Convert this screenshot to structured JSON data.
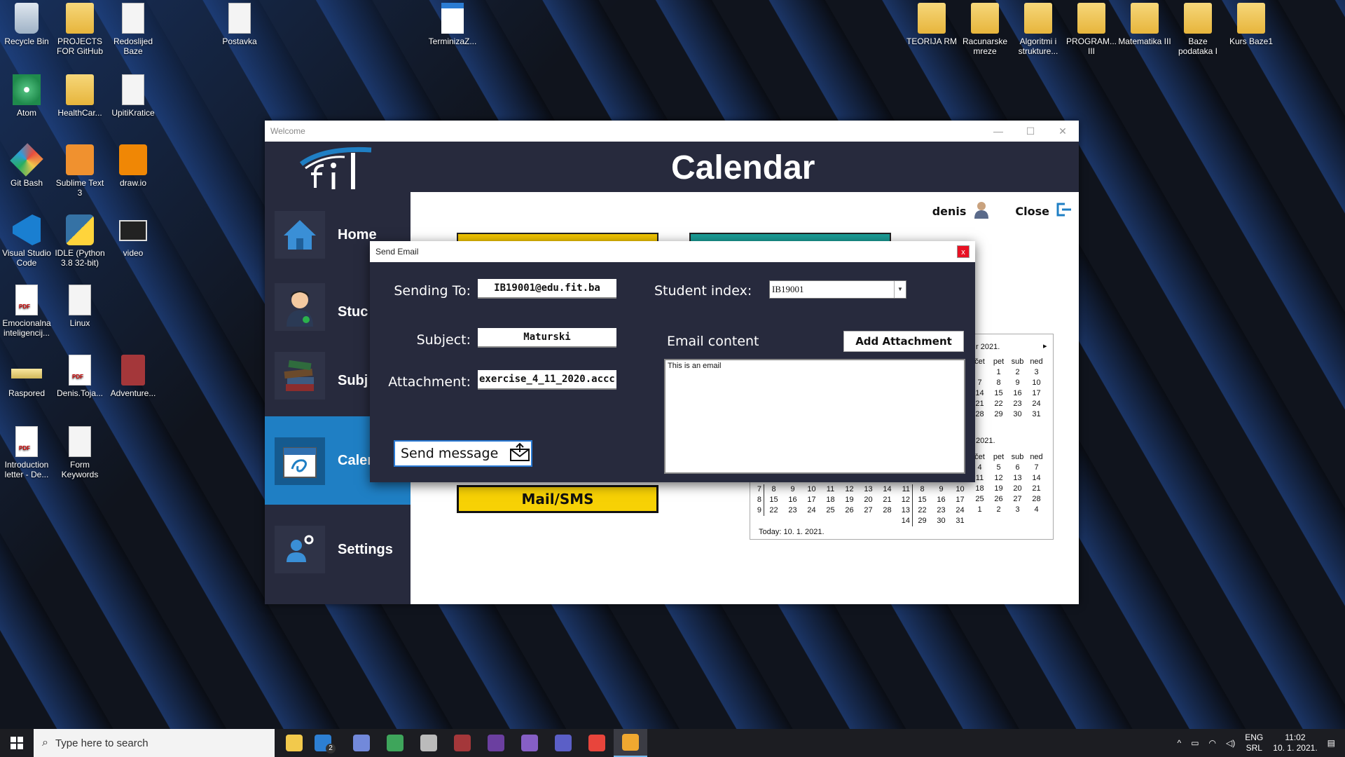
{
  "desktop_icons": [
    {
      "label": "Recycle Bin",
      "type": "recycle",
      "icon": "recycle-bin-icon"
    },
    {
      "label": "PROJECTS FOR GitHub",
      "type": "folder",
      "icon": "folder-icon"
    },
    {
      "label": "Redoslijed Baze",
      "type": "doc",
      "icon": "document-icon"
    },
    {
      "label": "Postavka",
      "type": "doc",
      "icon": "archive-icon"
    },
    {
      "label": "TerminizaZ...",
      "type": "calendarfile",
      "icon": "calendar-file-icon"
    },
    {
      "label": "TEORIJA RM",
      "type": "folder",
      "icon": "folder-icon"
    },
    {
      "label": "Racunarske mreze",
      "type": "folder",
      "icon": "folder-icon"
    },
    {
      "label": "Algoritmi i strukture...",
      "type": "folder",
      "icon": "folder-icon"
    },
    {
      "label": "PROGRAM... III",
      "type": "folder",
      "icon": "folder-icon"
    },
    {
      "label": "Matematika III",
      "type": "folder",
      "icon": "folder-icon"
    },
    {
      "label": "Baze podataka I",
      "type": "folder",
      "icon": "folder-icon"
    },
    {
      "label": "Kurs Baze1",
      "type": "folder",
      "icon": "folder-icon"
    },
    {
      "label": "Atom",
      "type": "atom",
      "icon": "atom-icon"
    },
    {
      "label": "HealthCar...",
      "type": "folder",
      "icon": "folder-icon"
    },
    {
      "label": "UpitiKratice",
      "type": "doc",
      "icon": "document-icon"
    },
    {
      "label": "Git Bash",
      "type": "gitbash",
      "icon": "git-bash-icon"
    },
    {
      "label": "Sublime Text 3",
      "type": "sublime",
      "icon": "sublime-text-icon"
    },
    {
      "label": "draw.io",
      "type": "drawio",
      "icon": "drawio-icon"
    },
    {
      "label": "Visual Studio Code",
      "type": "vscode",
      "icon": "vscode-icon"
    },
    {
      "label": "IDLE (Python 3.8 32-bit)",
      "type": "python",
      "icon": "python-icon"
    },
    {
      "label": "video",
      "type": "video",
      "icon": "video-icon"
    },
    {
      "label": "Emocionalna inteligencij...",
      "type": "pdf",
      "icon": "pdf-icon"
    },
    {
      "label": "Linux",
      "type": "doc",
      "icon": "document-icon"
    },
    {
      "label": "Raspored",
      "type": "raspored",
      "icon": "image-icon"
    },
    {
      "label": "Denis.Toja...",
      "type": "pdf",
      "icon": "pdf-icon"
    },
    {
      "label": "Adventure...",
      "type": "access",
      "icon": "access-icon"
    },
    {
      "label": "Introduction letter - De...",
      "type": "pdf",
      "icon": "pdf-icon"
    },
    {
      "label": "Form Keywords",
      "type": "doc",
      "icon": "document-icon"
    }
  ],
  "window": {
    "title": "Welcome",
    "minimize": "—",
    "maximize": "☐",
    "close": "✕"
  },
  "app": {
    "title": "Calendar",
    "logo_text": "fil",
    "user_name": "denis",
    "close_label": "Close",
    "nav": [
      {
        "label": "Home",
        "icon": "home-icon"
      },
      {
        "label": "Stuc",
        "icon": "student-icon"
      },
      {
        "label": "Subj",
        "icon": "books-icon"
      },
      {
        "label": "Caler",
        "icon": "calendar-icon"
      },
      {
        "label": "Settings",
        "icon": "user-settings-icon"
      }
    ],
    "mail_sms_label": "Mail/SMS"
  },
  "calendar_widget": {
    "month1_header": "r 2021.",
    "month2_header": "2021.",
    "next_arrow": "▸",
    "day_headers": [
      "čet",
      "pet",
      "sub",
      "ned"
    ],
    "month1_rows": [
      [
        "",
        "1",
        "2",
        "3"
      ],
      [
        "7",
        "8",
        "9",
        "10"
      ],
      [
        "14",
        "15",
        "16",
        "17"
      ],
      [
        "21",
        "22",
        "23",
        "24"
      ],
      [
        "28",
        "29",
        "30",
        "31"
      ]
    ],
    "month2_rows": [
      [
        "4",
        "5",
        "6",
        "7"
      ],
      [
        "11",
        "12",
        "13",
        "14"
      ],
      [
        "18",
        "19",
        "20",
        "21"
      ],
      [
        "25",
        "26",
        "27",
        "28"
      ],
      [
        "1",
        "2",
        "3",
        "4"
      ]
    ],
    "left_weeks": [
      "7",
      "8",
      "9"
    ],
    "left_rows": [
      [
        "8",
        "9",
        "10",
        "11",
        "12",
        "13",
        "14"
      ],
      [
        "15",
        "16",
        "17",
        "18",
        "19",
        "20",
        "21"
      ],
      [
        "22",
        "23",
        "24",
        "25",
        "26",
        "27",
        "28"
      ]
    ],
    "right_weeks": [
      "11",
      "12",
      "13",
      "14"
    ],
    "right_rows": [
      [
        "8",
        "9",
        "10"
      ],
      [
        "15",
        "16",
        "17"
      ],
      [
        "22",
        "23",
        "24"
      ],
      [
        "29",
        "30",
        "31"
      ]
    ],
    "today_label": "Today: 10. 1. 2021."
  },
  "dialog": {
    "title": "Send Email",
    "close": "x",
    "sending_to_label": "Sending To:",
    "sending_to_value": "IB19001@edu.fit.ba",
    "subject_label": "Subject:",
    "subject_value": "Maturski",
    "attachment_label": "Attachment:",
    "attachment_value": "exercise_4_11_2020.accc",
    "student_index_label": "Student index:",
    "student_index_value": "IB19001",
    "email_content_label": "Email content",
    "add_attachment_label": "Add Attachment",
    "email_content_value": "This is an email",
    "send_label": "Send message"
  },
  "taskbar": {
    "search_placeholder": "Type here to search",
    "apps": [
      {
        "name": "file-explorer-icon",
        "color": "#f2c94c"
      },
      {
        "name": "mail-icon",
        "color": "#2d7fd3"
      },
      {
        "name": "discord-icon",
        "color": "#7289da"
      },
      {
        "name": "sourcetree-icon",
        "color": "#3ea55b"
      },
      {
        "name": "database-icon",
        "color": "#bbbbbb"
      },
      {
        "name": "access-icon",
        "color": "#a4373a"
      },
      {
        "name": "obs-icon",
        "color": "#6b3fa0"
      },
      {
        "name": "visual-studio-icon",
        "color": "#865fc5"
      },
      {
        "name": "teams-icon",
        "color": "#5b5fc7"
      },
      {
        "name": "chrome-icon",
        "color": "#e8453c"
      },
      {
        "name": "winforms-app-icon",
        "color": "#f0a830"
      }
    ],
    "lang_top": "ENG",
    "lang_bottom": "SRL",
    "time": "11:02",
    "date": "10. 1. 2021.",
    "mail_badge": "2"
  }
}
